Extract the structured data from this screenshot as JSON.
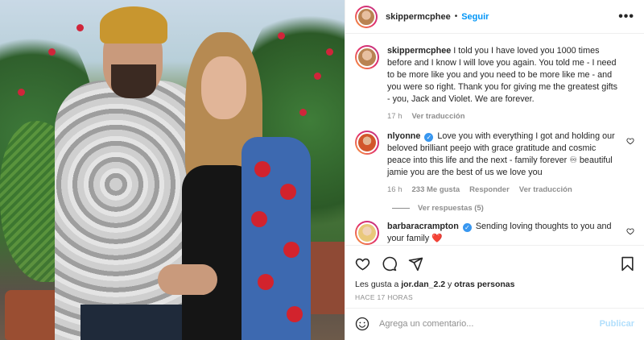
{
  "header": {
    "username": "skippermcphee",
    "dot": "•",
    "follow_label": "Seguir",
    "more_label": "•••"
  },
  "comments": [
    {
      "username": "skippermcphee",
      "verified": false,
      "text": "I told you I have loved you 1000 times before and I know I will love you again. You told me - I need to be more like you and you need to be more like me - and you were so right. Thank you for giving me the greatest gifts - you, Jack and Violet. We are forever.",
      "time": "17 h",
      "translate": "Ver traducción"
    },
    {
      "username": "nlyonne",
      "verified": true,
      "text": "Love you with everything I got and holding our beloved brilliant peejo with grace gratitude and cosmic peace into this life and the next - family forever ♾ beautiful jamie you are the best of us we love you",
      "time": "16 h",
      "likes": "233 Me gusta",
      "reply": "Responder",
      "translate": "Ver traducción",
      "view_replies": "Ver respuestas (5)"
    },
    {
      "username": "barbaracrampton",
      "verified": true,
      "text": "Sending loving thoughts to you and your family ❤️"
    }
  ],
  "actions": {
    "like_icon": "heart-icon",
    "comment_icon": "comment-icon",
    "share_icon": "send-icon",
    "save_icon": "bookmark-icon"
  },
  "likes": {
    "prefix": "Les gusta a",
    "user": "jor.dan_2.2",
    "middle": "y",
    "suffix": "otras personas"
  },
  "post_time": "HACE 17 HORAS",
  "add_comment": {
    "placeholder": "Agrega un comentario...",
    "publish_label": "Publicar",
    "emoji_icon": "emoji-icon"
  },
  "colors": {
    "accent": "#0095f6",
    "publish_disabled": "#b2dffc",
    "muted": "#8e8e8e",
    "verified": "#3897f0"
  }
}
